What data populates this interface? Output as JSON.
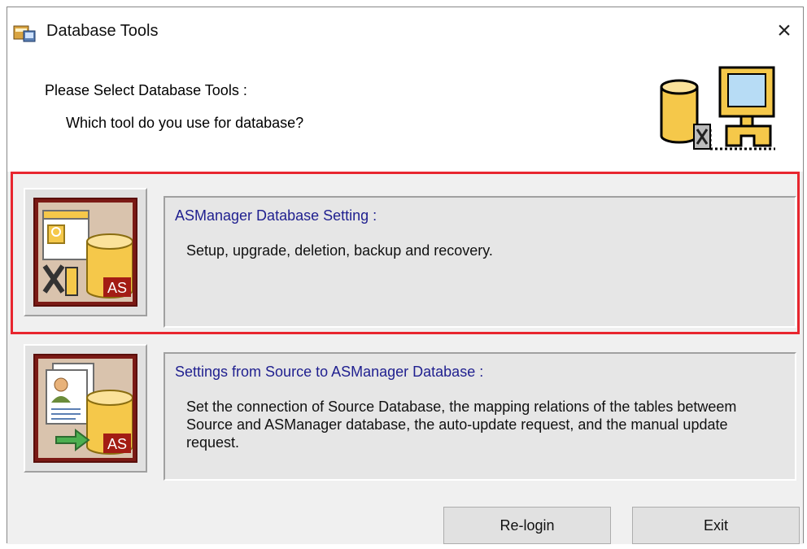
{
  "window": {
    "title": "Database Tools",
    "close_glyph": "×"
  },
  "header": {
    "prompt": "Please Select Database Tools :",
    "question": "Which tool do you use for database?",
    "graphic_icon": "database-computer-icon"
  },
  "tools": [
    {
      "title": "ASManager Database Setting :",
      "description": "Setup, upgrade, deletion, backup and recovery.",
      "icon": "database-settings-icon",
      "badge": "AS",
      "highlighted": true
    },
    {
      "title": "Settings from Source to ASManager Database :",
      "description": "Set the connection of Source Database, the mapping relations of the tables betweem Source and ASManager database, the auto-update request, and the manual update request.",
      "icon": "database-mapping-icon",
      "badge": "AS",
      "highlighted": false
    }
  ],
  "buttons": {
    "relogin": "Re-login",
    "exit": "Exit"
  },
  "colors": {
    "highlight_border": "#e8262f",
    "tool_title": "#1f1f8f",
    "icon_frame": "#7b1a15",
    "database_gold": "#f5c84a"
  }
}
